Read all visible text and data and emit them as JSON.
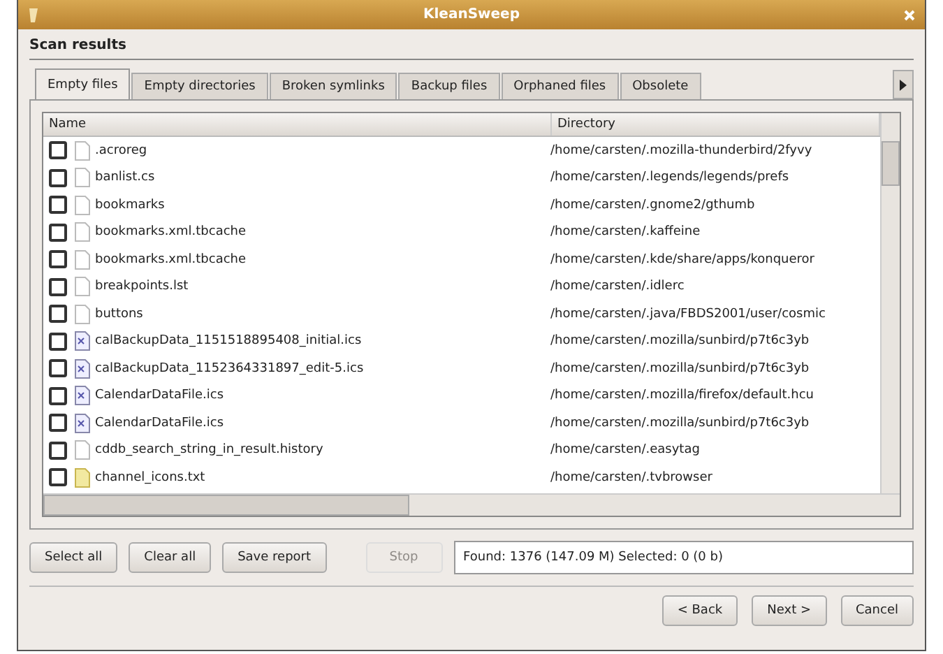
{
  "window": {
    "title": "KleanSweep"
  },
  "section_title": "Scan results",
  "tabs": [
    {
      "label": "Empty files",
      "selected": true
    },
    {
      "label": "Empty directories",
      "selected": false
    },
    {
      "label": "Broken symlinks",
      "selected": false
    },
    {
      "label": "Backup files",
      "selected": false
    },
    {
      "label": "Orphaned files",
      "selected": false
    },
    {
      "label": "Obsolete",
      "selected": false
    }
  ],
  "table": {
    "columns": [
      "Name",
      "Directory"
    ],
    "rows": [
      {
        "checked": false,
        "kind": "file",
        "name": ".acroreg",
        "directory": "/home/carsten/.mozilla-thunderbird/2fyvy"
      },
      {
        "checked": false,
        "kind": "file",
        "name": "banlist.cs",
        "directory": "/home/carsten/.legends/legends/prefs"
      },
      {
        "checked": false,
        "kind": "file",
        "name": "bookmarks",
        "directory": "/home/carsten/.gnome2/gthumb"
      },
      {
        "checked": false,
        "kind": "file",
        "name": "bookmarks.xml.tbcache",
        "directory": "/home/carsten/.kaffeine"
      },
      {
        "checked": false,
        "kind": "file",
        "name": "bookmarks.xml.tbcache",
        "directory": "/home/carsten/.kde/share/apps/konqueror"
      },
      {
        "checked": false,
        "kind": "file",
        "name": "breakpoints.lst",
        "directory": "/home/carsten/.idlerc"
      },
      {
        "checked": false,
        "kind": "file",
        "name": "buttons",
        "directory": "/home/carsten/.java/FBDS2001/user/cosmic"
      },
      {
        "checked": false,
        "kind": "calendar",
        "name": "calBackupData_1151518895408_initial.ics",
        "directory": "/home/carsten/.mozilla/sunbird/p7t6c3yb"
      },
      {
        "checked": false,
        "kind": "calendar",
        "name": "calBackupData_1152364331897_edit-5.ics",
        "directory": "/home/carsten/.mozilla/sunbird/p7t6c3yb"
      },
      {
        "checked": false,
        "kind": "calendar",
        "name": "CalendarDataFile.ics",
        "directory": "/home/carsten/.mozilla/firefox/default.hcu"
      },
      {
        "checked": false,
        "kind": "calendar",
        "name": "CalendarDataFile.ics",
        "directory": "/home/carsten/.mozilla/sunbird/p7t6c3yb"
      },
      {
        "checked": false,
        "kind": "file",
        "name": "cddb_search_string_in_result.history",
        "directory": "/home/carsten/.easytag"
      },
      {
        "checked": false,
        "kind": "text",
        "name": "channel_icons.txt",
        "directory": "/home/carsten/.tvbrowser"
      }
    ]
  },
  "actions": [
    {
      "label": "Select all",
      "disabled": false
    },
    {
      "label": "Clear all",
      "disabled": false
    },
    {
      "label": "Save report",
      "disabled": false
    },
    {
      "label": "Stop",
      "disabled": true
    }
  ],
  "status": "Found: 1376 (147.09 M) Selected: 0 (0 b)",
  "nav_buttons": [
    "< Back",
    "Next >",
    "Cancel"
  ]
}
